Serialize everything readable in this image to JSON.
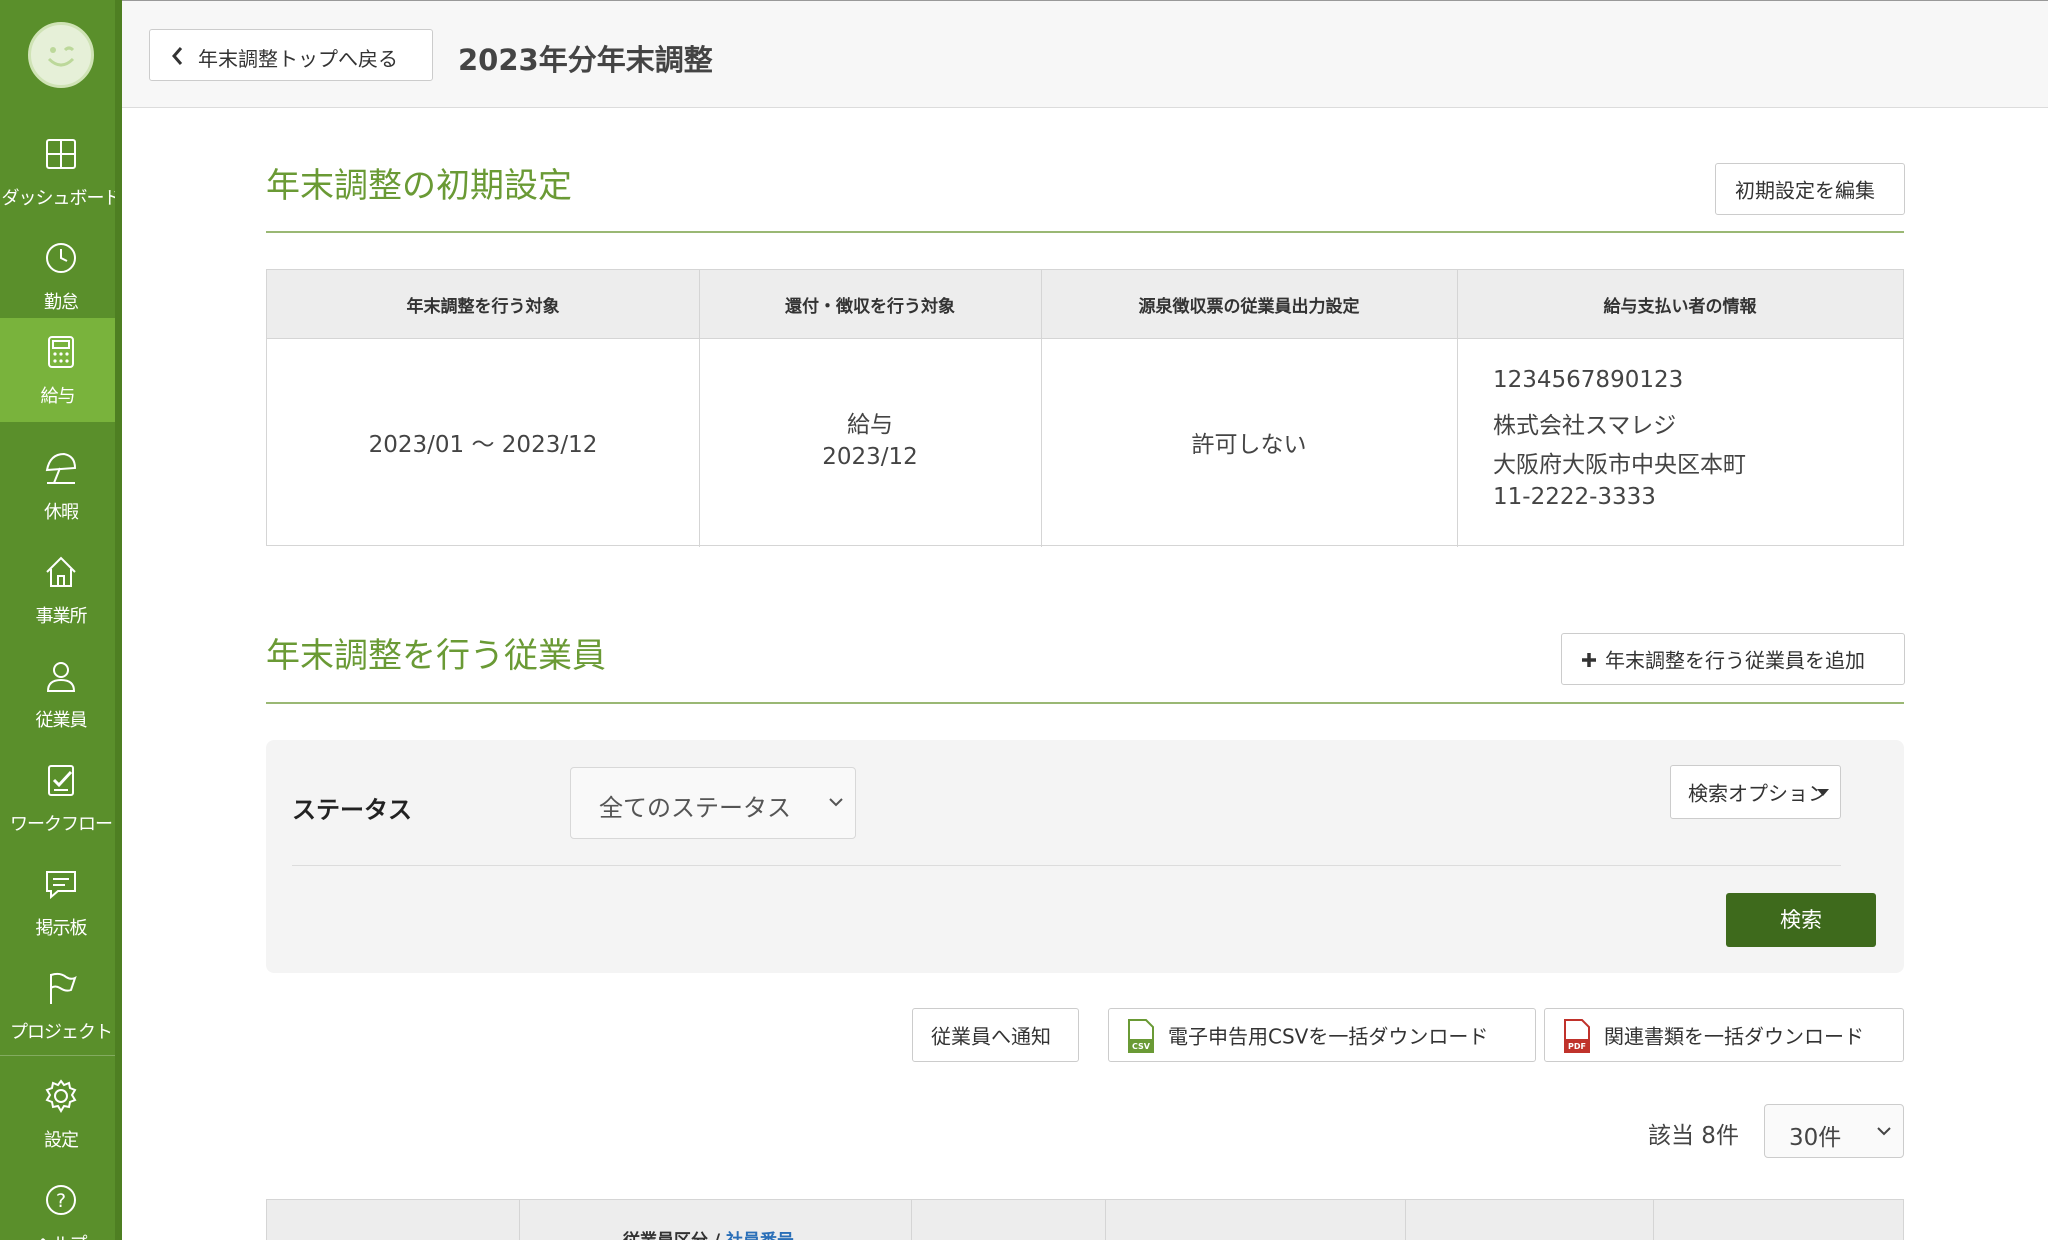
{
  "sidebar": {
    "items": [
      {
        "label": "ダッシュボード",
        "icon": "dashboard-icon"
      },
      {
        "label": "勤怠",
        "icon": "clock-icon"
      },
      {
        "label": "給与",
        "icon": "calculator-icon"
      },
      {
        "label": "休暇",
        "icon": "umbrella-icon"
      },
      {
        "label": "事業所",
        "icon": "home-icon"
      },
      {
        "label": "従業員",
        "icon": "person-icon"
      },
      {
        "label": "ワークフロー",
        "icon": "checklist-icon"
      },
      {
        "label": "掲示板",
        "icon": "chat-icon"
      },
      {
        "label": "プロジェクト",
        "icon": "flag-icon"
      },
      {
        "label": "設定",
        "icon": "gear-icon"
      },
      {
        "label": "ヘルプ",
        "icon": "help-icon"
      }
    ],
    "active": "給与",
    "colors": {
      "background": "#5a8f2b",
      "active": "#79b33c"
    }
  },
  "header": {
    "back_label": "年末調整トップへ戻る",
    "title": "2023年分年末調整"
  },
  "initial_settings": {
    "title": "年末調整の初期設定",
    "edit_label": "初期設定を編集",
    "columns": [
      "年末調整を行う対象",
      "還付・徴収を行う対象",
      "源泉徴収票の従業員出力設定",
      "給与支払い者の情報"
    ],
    "cells": {
      "target_period": "2023/01 〜 2023/12",
      "refund_line1": "給与",
      "refund_line2": "2023/12",
      "output_setting": "許可しない",
      "payer_number": "1234567890123",
      "payer_company": "株式会社スマレジ",
      "payer_address": "大阪府大阪市中央区本町",
      "payer_phone": "11-2222-3333"
    }
  },
  "employees_section": {
    "title": "年末調整を行う従業員",
    "add_label": "年末調整を行う従業員を追加",
    "status_label": "ステータス",
    "status_value": "全てのステータス",
    "search_options_label": "検索オプション",
    "search_label": "検索",
    "notify_label": "従業員へ通知",
    "csv_download_label": "電子申告用CSVを一括ダウンロード",
    "docs_download_label": "関連書類を一括ダウンロード",
    "count_label": "該当 8件",
    "per_page_value": "30件",
    "table_header_part1": "従業員区分 / ",
    "table_header_link": "社員番号"
  },
  "colors": {
    "accent": "#6a9a35",
    "search_button": "#3e6a1c",
    "link": "#2a6fb8"
  }
}
